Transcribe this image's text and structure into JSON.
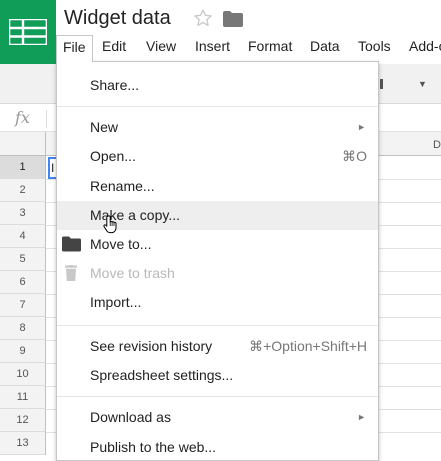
{
  "app": {
    "doc_title": "Widget data",
    "brand_color": "#0f9d58"
  },
  "menubar": {
    "items": [
      {
        "id": "file",
        "label": "File",
        "active": true
      },
      {
        "id": "edit",
        "label": "Edit"
      },
      {
        "id": "view",
        "label": "View"
      },
      {
        "id": "insert",
        "label": "Insert"
      },
      {
        "id": "format",
        "label": "Format"
      },
      {
        "id": "data",
        "label": "Data"
      },
      {
        "id": "tools",
        "label": "Tools"
      },
      {
        "id": "addons",
        "label": "Add-o"
      }
    ]
  },
  "formula_bar": {
    "fx_label": "fx"
  },
  "grid": {
    "column_label_visible": "D",
    "selected_cell_text": "I",
    "rows": [
      "1",
      "2",
      "3",
      "4",
      "5",
      "6",
      "7",
      "8",
      "9",
      "10",
      "11",
      "12",
      "13"
    ]
  },
  "file_menu": {
    "share": "Share...",
    "new": "New",
    "open": "Open...",
    "open_shortcut": "⌘O",
    "rename": "Rename...",
    "make_copy": "Make a copy...",
    "move_to": "Move to...",
    "move_to_trash": "Move to trash",
    "import": "Import...",
    "revision_history": "See revision history",
    "revision_history_shortcut": "⌘+Option+Shift+H",
    "spreadsheet_settings": "Spreadsheet settings...",
    "download_as": "Download as",
    "publish": "Publish to the web...",
    "submenu_arrow": "►"
  },
  "icons": {
    "logo": "sheets-logo-icon",
    "star": "star-icon",
    "folder": "folder-icon",
    "move_to": "folder-icon",
    "trash": "trash-icon",
    "cursor": "hand-pointer-icon"
  }
}
